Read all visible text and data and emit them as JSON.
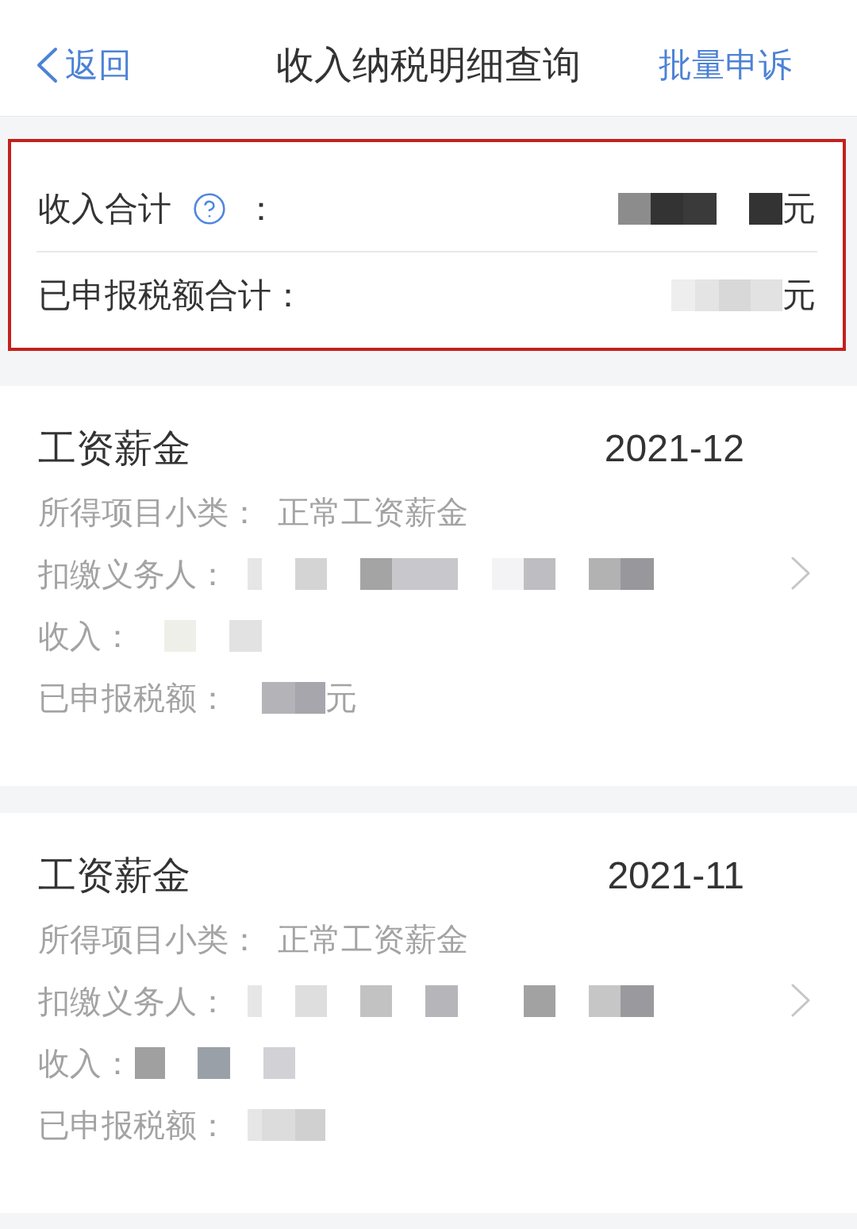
{
  "header": {
    "back_label": "返回",
    "title": "收入纳税明细查询",
    "action_label": "批量申诉"
  },
  "summary": {
    "highlighted": true,
    "rows": [
      {
        "label": "收入合计",
        "help_icon": true,
        "separator": "：",
        "unit": "元"
      },
      {
        "label": "已申报税额合计：",
        "help_icon": false,
        "unit": "元"
      }
    ]
  },
  "records": [
    {
      "category": "工资薪金",
      "period": "2021-12",
      "fields": [
        {
          "label": "所得项目小类：",
          "redacted": false,
          "value": "正常工资薪金"
        },
        {
          "label": "扣缴义务人：",
          "redacted": true
        },
        {
          "label": "收入：",
          "redacted": true
        },
        {
          "label": "已申报税额：",
          "redacted": true,
          "unit": "元"
        }
      ]
    },
    {
      "category": "工资薪金",
      "period": "2021-11",
      "fields": [
        {
          "label": "所得项目小类：",
          "redacted": false,
          "value": "正常工资薪金"
        },
        {
          "label": "扣缴义务人：",
          "redacted": true
        },
        {
          "label": "收入：",
          "redacted": true
        },
        {
          "label": "已申报税额：",
          "redacted": true
        }
      ]
    }
  ]
}
